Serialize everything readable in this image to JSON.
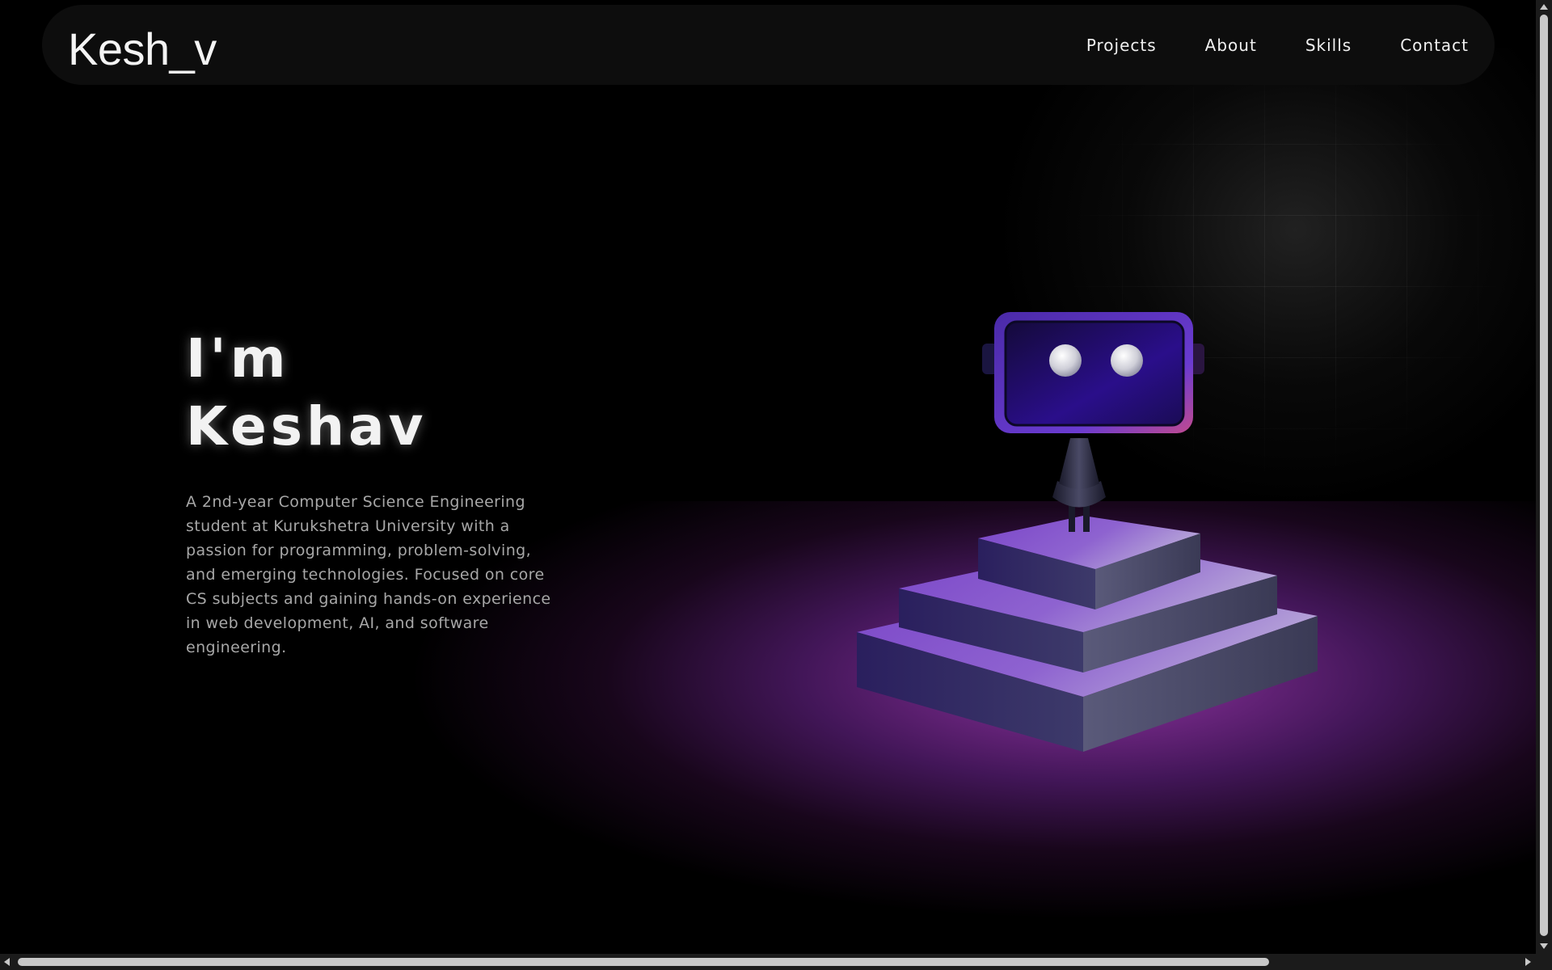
{
  "nav": {
    "logo": "Kesh_v",
    "links": [
      {
        "label": "Projects"
      },
      {
        "label": "About"
      },
      {
        "label": "Skills"
      },
      {
        "label": "Contact"
      }
    ]
  },
  "hero": {
    "title_line1": "I'm",
    "title_line2": "Keshav",
    "description": "A 2nd-year Computer Science Engineering student at Kurukshetra University with a passion for programming, problem-solving, and emerging technologies. Focused on core CS subjects and gaining hands-on experience in web development, AI, and software engineering."
  },
  "theme": {
    "background": "#000000",
    "navbar": "#0d0d0d",
    "accent_purple": "#5b2bb8",
    "floor_glow": "#a83cc0",
    "text_primary": "#f2f2f2",
    "text_secondary": "#a7a7a7"
  },
  "scene": {
    "subject": "robot-on-stepped-pedestal-3d-render"
  }
}
